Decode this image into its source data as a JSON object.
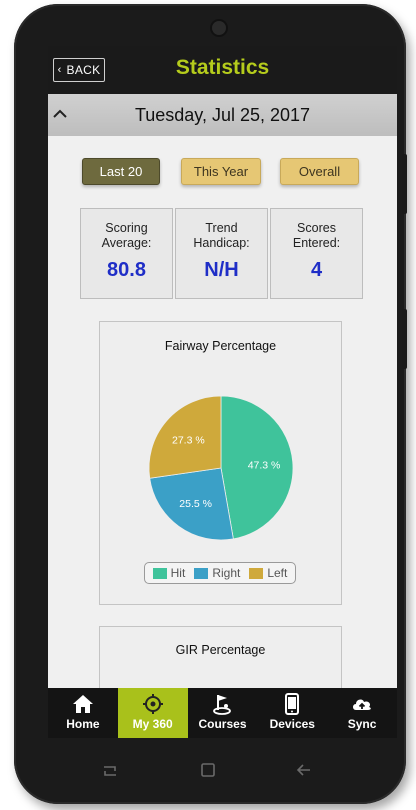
{
  "header": {
    "back_label": "BACK",
    "title": "Statistics"
  },
  "date_bar": {
    "date": "Tuesday, Jul 25, 2017"
  },
  "filters": [
    {
      "label": "Last 20",
      "active": true
    },
    {
      "label": "This Year",
      "active": false
    },
    {
      "label": "Overall",
      "active": false
    }
  ],
  "stats": [
    {
      "label": "Scoring\nAverage:",
      "value": "80.8"
    },
    {
      "label": "Trend\nHandicap:",
      "value": "N/H"
    },
    {
      "label": "Scores\nEntered:",
      "value": "4"
    }
  ],
  "chart_data": {
    "type": "pie",
    "title": "Fairway Percentage",
    "categories": [
      "Hit",
      "Right",
      "Left"
    ],
    "values": [
      47.3,
      25.5,
      27.3
    ],
    "labels": [
      "47.3 %",
      "25.5 %",
      "27.3 %"
    ],
    "colors": [
      "#3fc39b",
      "#3ba0c7",
      "#cfa93b"
    ],
    "legend_position": "bottom"
  },
  "gir_card": {
    "title": "GIR Percentage"
  },
  "tabs": [
    {
      "label": "Home",
      "icon": "home-icon",
      "active": false
    },
    {
      "label": "My 360",
      "icon": "target-icon",
      "active": true
    },
    {
      "label": "Courses",
      "icon": "golf-flag-icon",
      "active": false
    },
    {
      "label": "Devices",
      "icon": "phone-icon",
      "active": false
    },
    {
      "label": "Sync",
      "icon": "cloud-upload-icon",
      "active": false
    }
  ]
}
